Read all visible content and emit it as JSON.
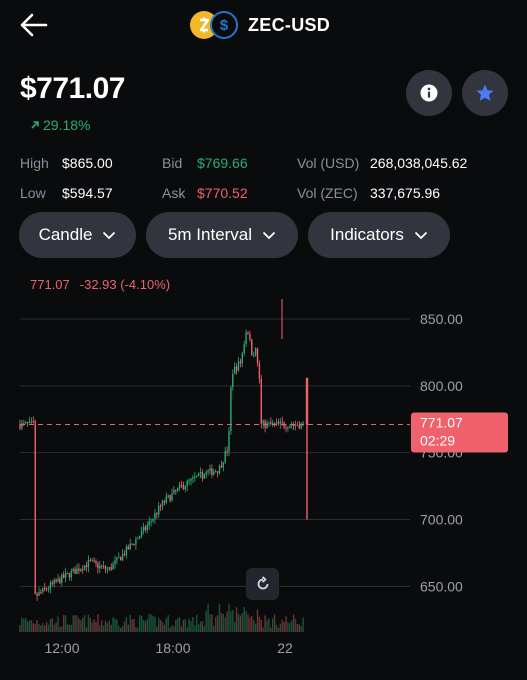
{
  "header": {
    "pair": "ZEC-USD",
    "coin_icons": [
      "zcash-icon",
      "usd-coin-icon"
    ]
  },
  "price": {
    "current": "$771.07",
    "change": "29.18%"
  },
  "stats": {
    "high_label": "High",
    "high": "$865.00",
    "low_label": "Low",
    "low": "$594.57",
    "bid_label": "Bid",
    "bid": "$769.66",
    "ask_label": "Ask",
    "ask": "$770.52",
    "vol_usd_label": "Vol (USD)",
    "vol_usd": "268,038,045.62",
    "vol_zec_label": "Vol (ZEC)",
    "vol_zec": "337,675.96"
  },
  "controls": {
    "chart_type": "Candle",
    "interval": "5m Interval",
    "indicators": "Indicators"
  },
  "chart_info": {
    "last": "771.07",
    "change": "-32.93 (-4.10%)"
  },
  "colors": {
    "up": "#27ad75",
    "down": "#f0616d",
    "accent": "#4a7cf6",
    "background": "#0a0b0d"
  },
  "chart_data": {
    "type": "candlestick",
    "y_ticks": [
      "850.00",
      "800.00",
      "750.00",
      "700.00",
      "650.00"
    ],
    "x_ticks": [
      "12:00",
      "18:00",
      "22"
    ],
    "ylim": [
      620,
      870
    ],
    "price_label": {
      "value": "771.07",
      "countdown": "02:29"
    },
    "approx_path": [
      {
        "x": "10:30",
        "y": 642
      },
      {
        "x": "12:00",
        "y": 656
      },
      {
        "x": "13:30",
        "y": 668
      },
      {
        "x": "14:30",
        "y": 662
      },
      {
        "x": "15:30",
        "y": 677
      },
      {
        "x": "16:30",
        "y": 693
      },
      {
        "x": "17:30",
        "y": 713
      },
      {
        "x": "18:30",
        "y": 725
      },
      {
        "x": "19:30",
        "y": 733
      },
      {
        "x": "20:30",
        "y": 738
      },
      {
        "x": "21:00",
        "y": 755
      },
      {
        "x": "21:10",
        "y": 810
      },
      {
        "x": "21:40",
        "y": 818
      },
      {
        "x": "22:00",
        "y": 845
      },
      {
        "x": "22:15",
        "y": 825
      },
      {
        "x": "22:30",
        "y": 826
      },
      {
        "x": "22:40",
        "y": 805
      },
      {
        "x": "22:45",
        "y": 771
      }
    ],
    "high": 865,
    "low": 700
  }
}
